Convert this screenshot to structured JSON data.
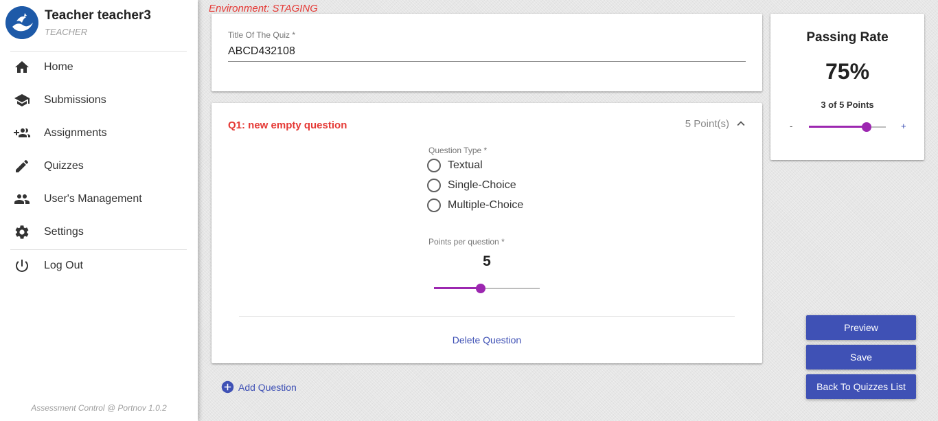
{
  "environment_label": "Environment: STAGING",
  "sidebar": {
    "user_name": "Teacher teacher3",
    "user_role": "TEACHER",
    "items": [
      {
        "label": "Home",
        "icon": "home-icon"
      },
      {
        "label": "Submissions",
        "icon": "school-icon"
      },
      {
        "label": "Assignments",
        "icon": "group-add-icon"
      },
      {
        "label": "Quizzes",
        "icon": "pencil-icon"
      },
      {
        "label": "User's Management",
        "icon": "people-icon"
      },
      {
        "label": "Settings",
        "icon": "gear-icon"
      }
    ],
    "logout": {
      "label": "Log Out",
      "icon": "power-icon"
    },
    "footer": "Assessment Control @ Portnov 1.0.2"
  },
  "quiz": {
    "title_label": "Title Of The Quiz *",
    "title_value": "ABCD432108"
  },
  "question": {
    "title": "Q1: new empty question",
    "points": "5 Point(s)",
    "type_label": "Question Type *",
    "types": [
      "Textual",
      "Single-Choice",
      "Multiple-Choice"
    ],
    "points_label": "Points per question *",
    "points_value": "5",
    "points_slider": {
      "value": 5,
      "min": 1,
      "max": 10
    },
    "delete_label": "Delete Question"
  },
  "add_question_label": "Add Question",
  "passing_rate": {
    "title": "Passing Rate",
    "value": "75%",
    "subtitle": "3 of 5 Points",
    "minus": "-",
    "plus": "+",
    "slider_fraction": 0.75
  },
  "actions": {
    "preview": "Preview",
    "save": "Save",
    "back": "Back To Quizzes List"
  },
  "colors": {
    "accent": "#9c27b0",
    "primary": "#3f51b5",
    "danger": "#e53935"
  }
}
